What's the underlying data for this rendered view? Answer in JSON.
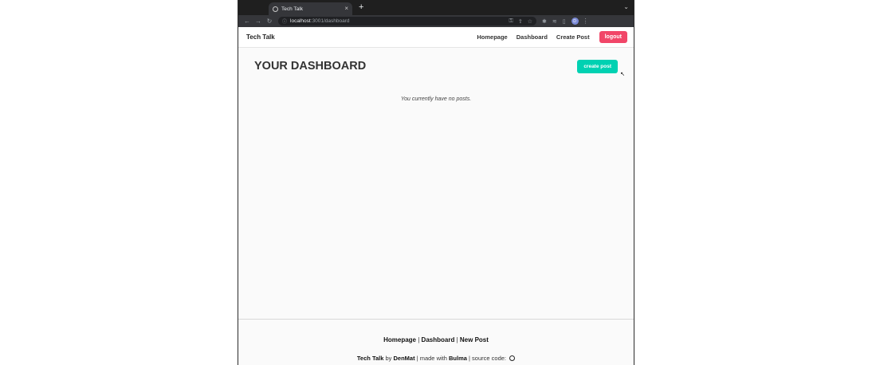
{
  "browser": {
    "tab_title": "Tech Talk",
    "new_tab": "+",
    "tab_close": "×",
    "url_host": "localhost",
    "url_rest": ":3001/dashboard",
    "profile_initial": "D"
  },
  "navbar": {
    "brand": "Tech Talk",
    "links": [
      "Homepage",
      "Dashboard",
      "Create Post"
    ],
    "logout_label": "logout"
  },
  "dashboard": {
    "title": "YOUR DASHBOARD",
    "create_post_label": "create post",
    "empty_message": "You currently have no posts."
  },
  "footer": {
    "links": [
      "Homepage",
      "Dashboard",
      "New Post"
    ],
    "separator": "|",
    "credit": {
      "app_name": "Tech Talk",
      "by_text": "by",
      "author": "DenMat",
      "made_with_text": "| made with",
      "framework": "Bulma",
      "source_text": "| source code:"
    }
  },
  "colors": {
    "logout_button": "#f14668",
    "create_post_button": "#00d1b2"
  }
}
